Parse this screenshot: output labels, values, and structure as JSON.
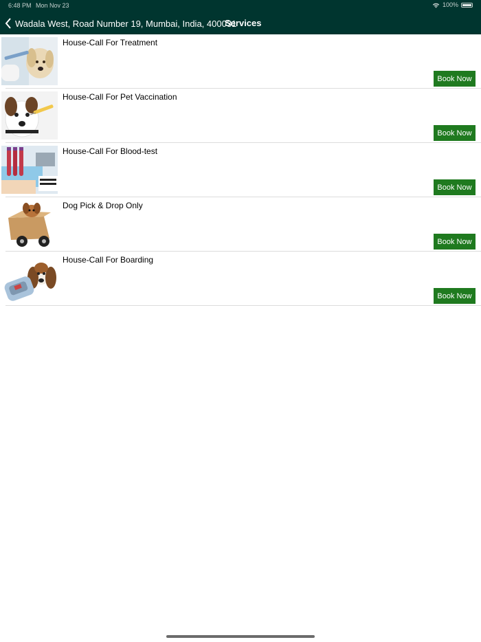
{
  "status_bar": {
    "time": "6:48 PM",
    "date": "Mon Nov 23",
    "battery": "100%"
  },
  "nav": {
    "back_label": "Wadala West, Road Number 19, Mumbai, India, 400031",
    "title": "Services"
  },
  "services": [
    {
      "title": "House-Call For Treatment",
      "button": "Book Now",
      "image": "dog-and-syringe-photo"
    },
    {
      "title": "House-Call For Pet Vaccination",
      "button": "Book Now",
      "image": "dog-vaccination-photo"
    },
    {
      "title": "House-Call For Blood-test",
      "button": "Book Now",
      "image": "blood-test-tubes-photo"
    },
    {
      "title": "Dog Pick & Drop Only",
      "button": "Book Now",
      "image": "dog-in-box-cart-photo"
    },
    {
      "title": "House-Call For Boarding",
      "button": "Book Now",
      "image": "dog-with-suitcase-photo"
    }
  ],
  "colors": {
    "header_bg": "#00352f",
    "button_bg": "#1f7a1f"
  }
}
